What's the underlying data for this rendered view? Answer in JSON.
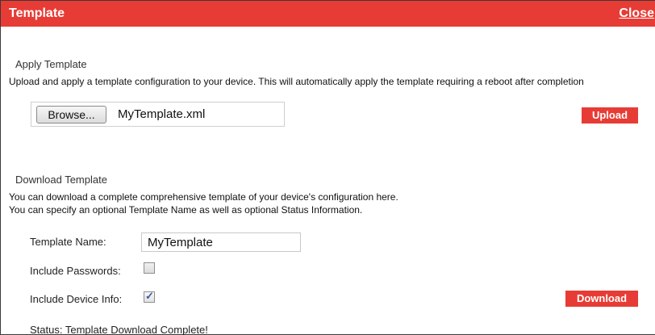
{
  "dialog": {
    "title": "Template",
    "close_label": "Close"
  },
  "apply": {
    "heading": "Apply Template",
    "description": "Upload and apply a template configuration to your device. This will automatically apply the template requiring a reboot after completion",
    "browse_label": "Browse...",
    "file_name": "MyTemplate.xml",
    "upload_label": "Upload"
  },
  "download": {
    "heading": "Download Template",
    "description_line1": "You can download a complete comprehensive template of your device's configuration here.",
    "description_line2": "You can specify an optional Template Name as well as optional Status Information.",
    "template_name_label": "Template Name:",
    "template_name_value": "MyTemplate",
    "include_passwords_label": "Include Passwords:",
    "include_passwords_checked": false,
    "include_device_info_label": "Include Device Info:",
    "include_device_info_checked": true,
    "download_label": "Download",
    "status": "Status: Template Download Complete!"
  },
  "colors": {
    "accent": "#e73c35",
    "check": "#3b5a9e"
  },
  "icons": {
    "checkbox_checked": "check-mark-icon"
  }
}
